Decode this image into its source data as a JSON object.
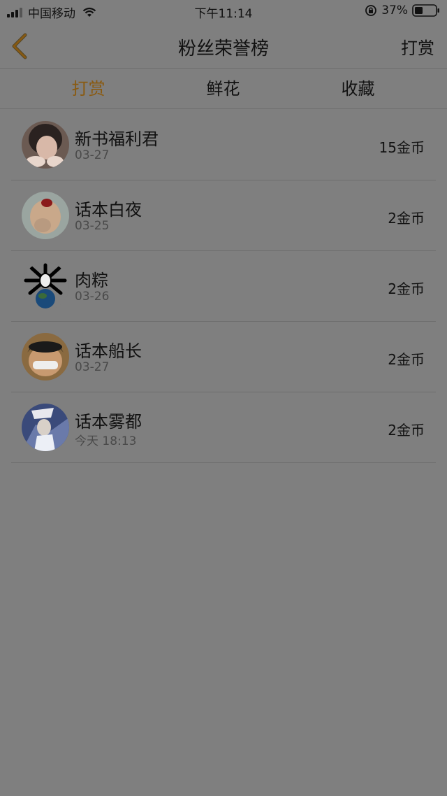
{
  "status_bar": {
    "carrier": "中国移动",
    "time": "下午11:14",
    "battery": "37%",
    "icons": [
      "signal-icon",
      "wifi-icon",
      "rotation-lock-icon",
      "battery-icon"
    ]
  },
  "nav": {
    "back_icon": "chevron-left-icon",
    "title": "粉丝荣誉榜",
    "reward_label": "打赏",
    "accent_color": "#8a5a10"
  },
  "tabs": [
    {
      "label": "打赏",
      "active": true
    },
    {
      "label": "鲜花",
      "active": false
    },
    {
      "label": "收藏",
      "active": false
    }
  ],
  "fans": [
    {
      "name": "新书福利君",
      "date": "03-27",
      "amount": "15金币"
    },
    {
      "name": "话本白夜",
      "date": "03-25",
      "amount": "2金币"
    },
    {
      "name": "肉粽",
      "date": "03-26",
      "amount": "2金币"
    },
    {
      "name": "话本船长",
      "date": "03-27",
      "amount": "2金币"
    },
    {
      "name": "话本雾都",
      "date": "今天 18:13",
      "amount": "2金币"
    }
  ]
}
